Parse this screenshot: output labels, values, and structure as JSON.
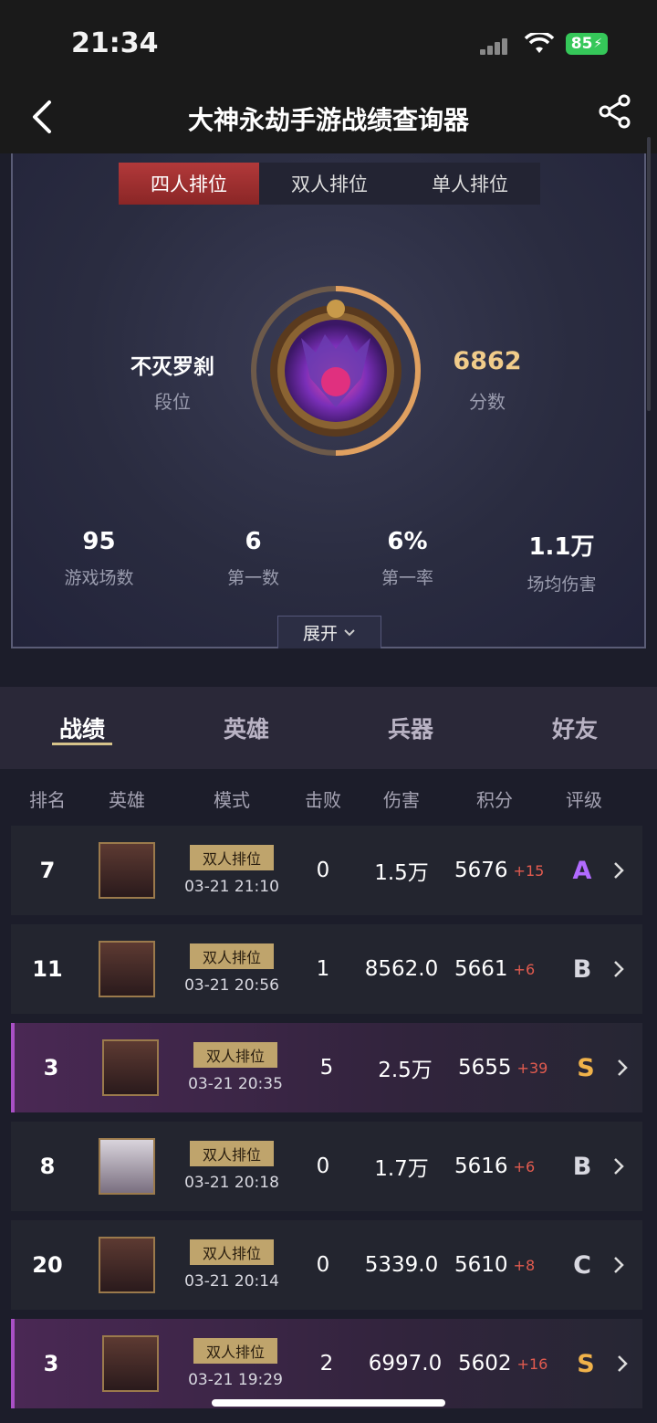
{
  "status": {
    "time": "21:34",
    "battery": "85"
  },
  "nav": {
    "title": "大神永劫手游战绩查询器"
  },
  "mode_tabs": [
    "四人排位",
    "双人排位",
    "单人排位"
  ],
  "rank": {
    "name": "不灭罗刹",
    "name_label": "段位",
    "score": "6862",
    "score_label": "分数"
  },
  "stats": [
    {
      "value": "95",
      "label": "游戏场数"
    },
    {
      "value": "6",
      "label": "第一数"
    },
    {
      "value": "6%",
      "label": "第一率"
    },
    {
      "value": "1.1万",
      "label": "场均伤害"
    }
  ],
  "expand_label": "展开",
  "section_tabs": [
    "战绩",
    "英雄",
    "兵器",
    "好友"
  ],
  "table_headers": [
    "排名",
    "英雄",
    "模式",
    "击败",
    "伤害",
    "积分",
    "评级"
  ],
  "matches": [
    {
      "rank": "7",
      "mode": "双人排位",
      "time": "03-21 21:10",
      "kills": "0",
      "damage": "1.5万",
      "points": "5676",
      "delta": "+15",
      "grade": "A",
      "grade_color": "#b16bff",
      "highlight": false
    },
    {
      "rank": "11",
      "mode": "双人排位",
      "time": "03-21 20:56",
      "kills": "1",
      "damage": "8562.0",
      "points": "5661",
      "delta": "+6",
      "grade": "B",
      "grade_color": "#d8d8e0",
      "highlight": false
    },
    {
      "rank": "3",
      "mode": "双人排位",
      "time": "03-21 20:35",
      "kills": "5",
      "damage": "2.5万",
      "points": "5655",
      "delta": "+39",
      "grade": "S",
      "grade_color": "#f0b24a",
      "highlight": true
    },
    {
      "rank": "8",
      "mode": "双人排位",
      "time": "03-21 20:18",
      "kills": "0",
      "damage": "1.7万",
      "points": "5616",
      "delta": "+6",
      "grade": "B",
      "grade_color": "#d8d8e0",
      "highlight": false
    },
    {
      "rank": "20",
      "mode": "双人排位",
      "time": "03-21 20:14",
      "kills": "0",
      "damage": "5339.0",
      "points": "5610",
      "delta": "+8",
      "grade": "C",
      "grade_color": "#d8d8e0",
      "highlight": false
    },
    {
      "rank": "3",
      "mode": "双人排位",
      "time": "03-21 19:29",
      "kills": "2",
      "damage": "6997.0",
      "points": "5602",
      "delta": "+16",
      "grade": "S",
      "grade_color": "#f0b24a",
      "highlight": true
    }
  ]
}
